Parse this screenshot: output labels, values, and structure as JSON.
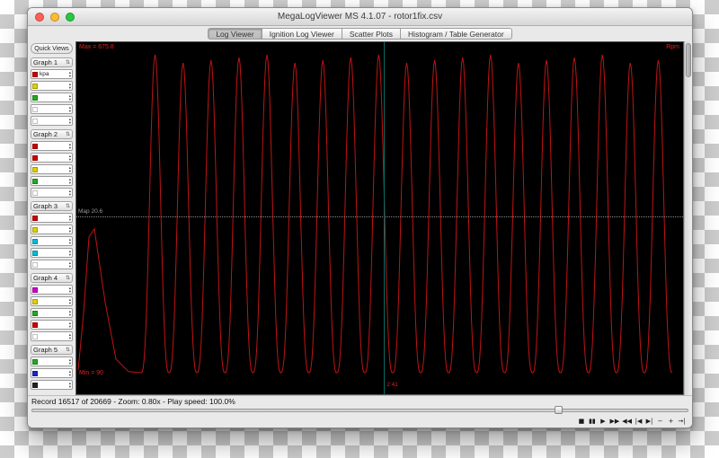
{
  "window": {
    "title": "MegaLogViewer MS 4.1.07 - rotor1fix.csv",
    "traffic_lights": {
      "close": "#ff5f57",
      "minimize": "#febc2e",
      "zoom": "#28c840"
    }
  },
  "tabs": [
    {
      "label": "Log Viewer",
      "selected": true
    },
    {
      "label": "Ignition Log Viewer",
      "selected": false
    },
    {
      "label": "Scatter Plots",
      "selected": false
    },
    {
      "label": "Histogram / Table Generator",
      "selected": false
    }
  ],
  "sidebar": {
    "quick_views_label": "Quick Views",
    "graphs": [
      {
        "label": "Graph 1",
        "selectors": [
          {
            "swatch": "#cc0000",
            "label": "kpa"
          },
          {
            "swatch": "#ddd000",
            "label": ""
          },
          {
            "swatch": "#22aa22",
            "label": ""
          },
          {
            "swatch": null,
            "label": ""
          },
          {
            "swatch": null,
            "label": ""
          }
        ]
      },
      {
        "label": "Graph 2",
        "selectors": [
          {
            "swatch": "#cc0000",
            "label": ""
          },
          {
            "swatch": "#cc0000",
            "label": ""
          },
          {
            "swatch": "#ddd000",
            "label": ""
          },
          {
            "swatch": "#22aa22",
            "label": ""
          },
          {
            "swatch": null,
            "label": ""
          }
        ]
      },
      {
        "label": "Graph 3",
        "selectors": [
          {
            "swatch": "#cc0000",
            "label": ""
          },
          {
            "swatch": "#ddd000",
            "label": ""
          },
          {
            "swatch": "#00bcd4",
            "label": ""
          },
          {
            "swatch": "#00bcd4",
            "label": ""
          },
          {
            "swatch": null,
            "label": ""
          }
        ]
      },
      {
        "label": "Graph 4",
        "selectors": [
          {
            "swatch": "#cc00cc",
            "label": ""
          },
          {
            "swatch": "#ddd000",
            "label": ""
          },
          {
            "swatch": "#22aa22",
            "label": ""
          },
          {
            "swatch": "#cc0000",
            "label": ""
          },
          {
            "swatch": null,
            "label": ""
          }
        ]
      },
      {
        "label": "Graph 5",
        "selectors": [
          {
            "swatch": "#22aa22",
            "label": ""
          },
          {
            "swatch": "#2222cc",
            "label": ""
          },
          {
            "swatch": "#222222",
            "label": ""
          }
        ]
      }
    ]
  },
  "plot": {
    "labels": {
      "max": "Max = 675.8",
      "series": "Rpm",
      "min": "Min = 90",
      "map": "Map 20.6",
      "cursor_time": "2:41"
    },
    "trace_color": "#c01414",
    "cursor_color": "#0d6b63",
    "cursor_fraction": 0.507,
    "map_fraction": 0.495,
    "waveform": {
      "min": 90,
      "max": 675.8,
      "cycles": 19,
      "sharpness": 1.45,
      "lead_in": [
        [
          2,
          95
        ],
        [
          8,
          200
        ],
        [
          14,
          340
        ],
        [
          20,
          355
        ],
        [
          32,
          220
        ],
        [
          44,
          115
        ],
        [
          58,
          92
        ],
        [
          72,
          90
        ]
      ]
    }
  },
  "chart_data": {
    "type": "line",
    "title": "",
    "series": [
      {
        "name": "Rpm",
        "min": 90,
        "max": 675.8,
        "cycles_visible": 19,
        "description": "periodic rpm oscillation between min 90 and max 675.8"
      },
      {
        "name": "Map",
        "value": 20.6,
        "style": "dotted-horizontal"
      }
    ],
    "cursor_record": 16517,
    "total_records": 20669
  },
  "status": {
    "text": "Record 16517 of 20669 - Zoom: 0.80x - Play speed: 100.0%",
    "slider_fraction": 0.8
  },
  "transport": {
    "buttons": [
      {
        "glyph": "■",
        "name": "stop"
      },
      {
        "glyph": "▮▮",
        "name": "pause"
      },
      {
        "glyph": "▶",
        "name": "play"
      },
      {
        "glyph": "▶▶",
        "name": "fast-forward"
      },
      {
        "glyph": "◀◀",
        "name": "rewind"
      },
      {
        "glyph": "|◀",
        "name": "skip-to-start"
      },
      {
        "glyph": "▶|",
        "name": "skip-to-end"
      },
      {
        "glyph": "−",
        "name": "speed-down"
      },
      {
        "glyph": "+",
        "name": "speed-up"
      },
      {
        "glyph": "→|",
        "name": "step-forward"
      }
    ]
  }
}
